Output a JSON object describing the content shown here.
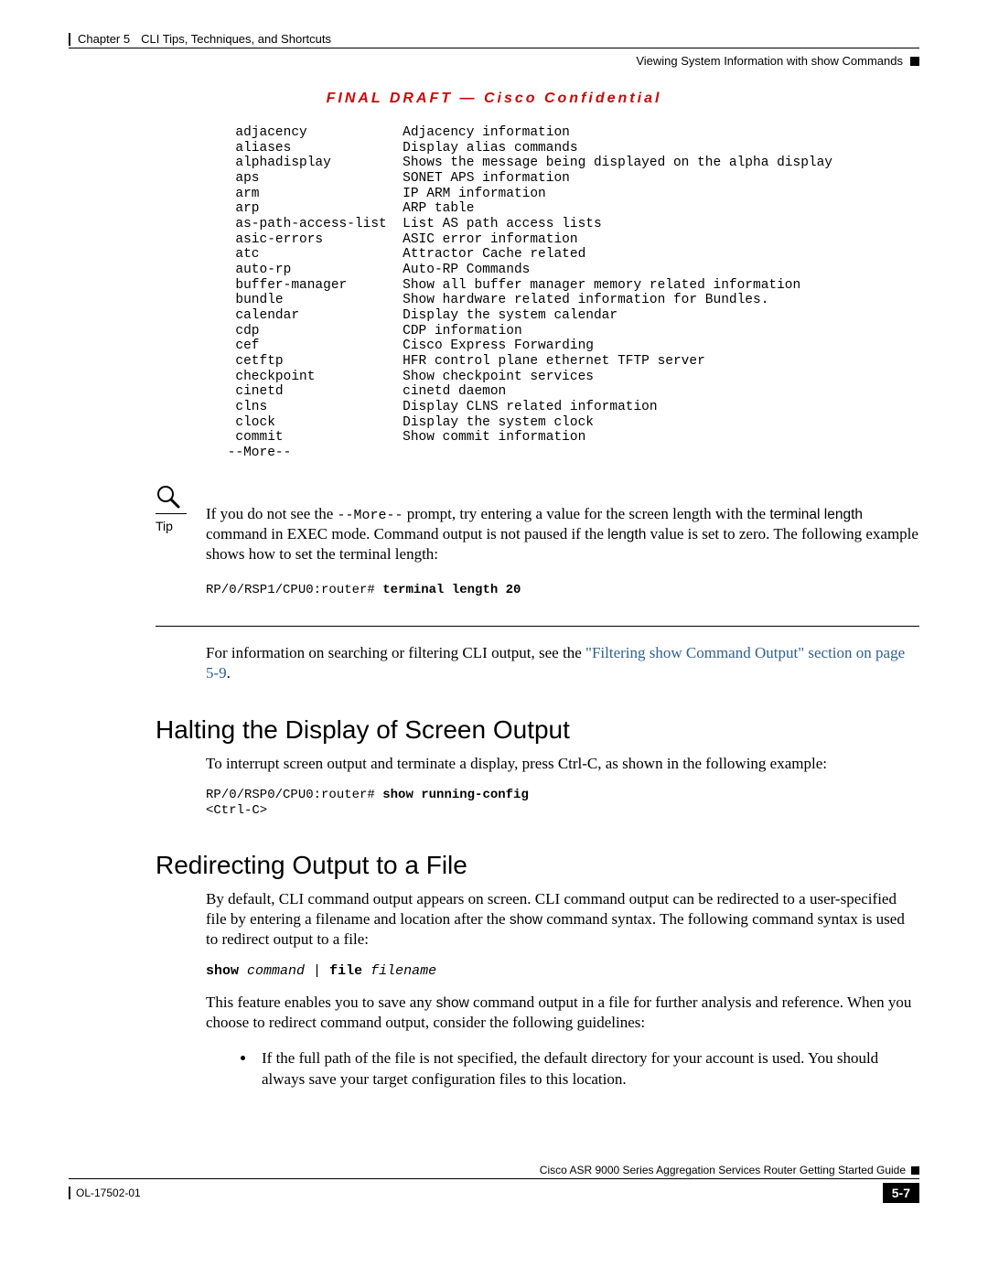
{
  "header": {
    "chapter": "Chapter 5",
    "chapter_title": "CLI Tips, Techniques, and Shortcuts",
    "section_right": "Viewing System Information with show Commands"
  },
  "confidential": "FINAL DRAFT — Cisco Confidential",
  "code_listing": "  adjacency            Adjacency information\n  aliases              Display alias commands\n  alphadisplay         Shows the message being displayed on the alpha display\n  aps                  SONET APS information\n  arm                  IP ARM information\n  arp                  ARP table\n  as-path-access-list  List AS path access lists\n  asic-errors          ASIC error information\n  atc                  Attractor Cache related\n  auto-rp              Auto-RP Commands\n  buffer-manager       Show all buffer manager memory related information\n  bundle               Show hardware related information for Bundles.\n  calendar             Display the system calendar\n  cdp                  CDP information\n  cef                  Cisco Express Forwarding\n  cetftp               HFR control plane ethernet TFTP server\n  checkpoint           Show checkpoint services\n  cinetd               cinetd daemon\n  clns                 Display CLNS related information\n  clock                Display the system clock\n  commit               Show commit information\n --More--",
  "tip": {
    "label": "Tip",
    "pre_text": "If you do not see the ",
    "more_prompt": "--More--",
    "mid_text_1": " prompt, try entering a value for the screen length with the ",
    "cmd1": "terminal length",
    "mid_text_2": " command in EXEC mode. Command output is not paused if the ",
    "cmd2": "length",
    "mid_text_3": " value is set to zero. The following example shows how to set the terminal length:"
  },
  "cmd_example1": {
    "prompt": "RP/0/RSP1/CPU0:router# ",
    "cmd": "terminal length 20"
  },
  "filter_text_pre": "For information on searching or filtering CLI output, see the ",
  "filter_link": "\"Filtering show Command Output\" section on page 5-9",
  "filter_text_post": ".",
  "section1": {
    "title": "Halting the Display of Screen Output",
    "body": "To interrupt screen output and terminate a display, press Ctrl-C, as shown in the following example:",
    "code": "RP/0/RSP0/CPU0:router# show running-config\n<Ctrl-C>",
    "code_prompt": "RP/0/RSP0/CPU0:router# ",
    "code_cmd": "show running-config",
    "code_line2": "<Ctrl-C>"
  },
  "section2": {
    "title": "Redirecting Output to a File",
    "body1_a": "By default, CLI command output appears on screen. CLI command output can be redirected to a user-specified file by entering a filename and location after the ",
    "show_word": "show",
    "body1_b": " command syntax. The following command syntax is used to redirect output to a file:",
    "syntax_show": "show",
    "syntax_command": "command",
    "syntax_pipe": " | ",
    "syntax_file": "file",
    "syntax_filename": "filename",
    "body2_a": "This feature enables you to save any ",
    "body2_b": " command output in a file for further analysis and reference. When you choose to redirect command output, consider the following guidelines:",
    "bullet1": "If the full path of the file is not specified, the default directory for your account is used. You should always save your target configuration files to this location."
  },
  "footer": {
    "guide": "Cisco ASR 9000 Series Aggregation Services Router Getting Started Guide",
    "doc_id": "OL-17502-01",
    "page": "5-7"
  }
}
